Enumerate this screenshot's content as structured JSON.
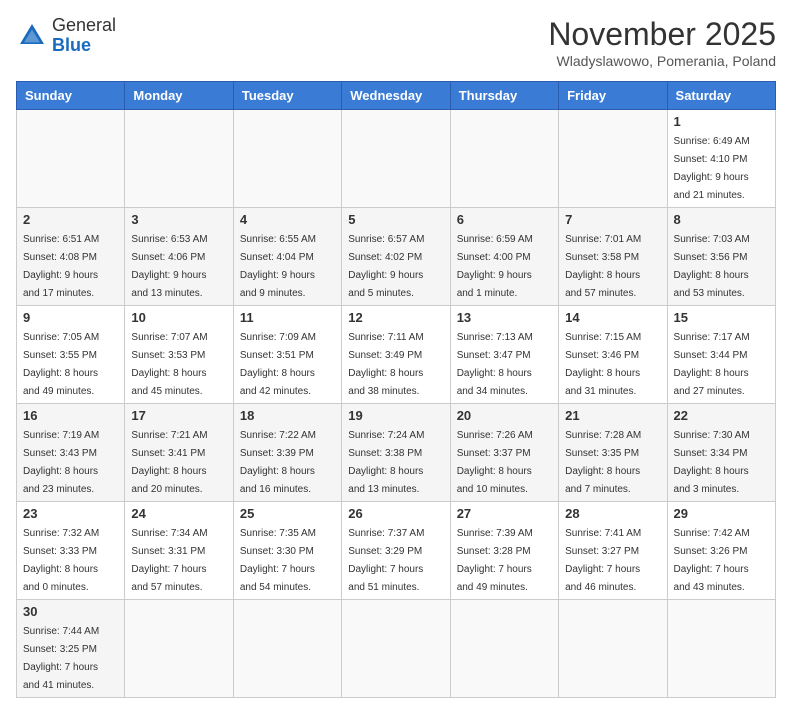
{
  "header": {
    "logo_general": "General",
    "logo_blue": "Blue",
    "month_title": "November 2025",
    "location": "Wladyslawowo, Pomerania, Poland"
  },
  "weekdays": [
    "Sunday",
    "Monday",
    "Tuesday",
    "Wednesday",
    "Thursday",
    "Friday",
    "Saturday"
  ],
  "days": {
    "d1": {
      "num": "1",
      "info": "Sunrise: 6:49 AM\nSunset: 4:10 PM\nDaylight: 9 hours\nand 21 minutes."
    },
    "d2": {
      "num": "2",
      "info": "Sunrise: 6:51 AM\nSunset: 4:08 PM\nDaylight: 9 hours\nand 17 minutes."
    },
    "d3": {
      "num": "3",
      "info": "Sunrise: 6:53 AM\nSunset: 4:06 PM\nDaylight: 9 hours\nand 13 minutes."
    },
    "d4": {
      "num": "4",
      "info": "Sunrise: 6:55 AM\nSunset: 4:04 PM\nDaylight: 9 hours\nand 9 minutes."
    },
    "d5": {
      "num": "5",
      "info": "Sunrise: 6:57 AM\nSunset: 4:02 PM\nDaylight: 9 hours\nand 5 minutes."
    },
    "d6": {
      "num": "6",
      "info": "Sunrise: 6:59 AM\nSunset: 4:00 PM\nDaylight: 9 hours\nand 1 minute."
    },
    "d7": {
      "num": "7",
      "info": "Sunrise: 7:01 AM\nSunset: 3:58 PM\nDaylight: 8 hours\nand 57 minutes."
    },
    "d8": {
      "num": "8",
      "info": "Sunrise: 7:03 AM\nSunset: 3:56 PM\nDaylight: 8 hours\nand 53 minutes."
    },
    "d9": {
      "num": "9",
      "info": "Sunrise: 7:05 AM\nSunset: 3:55 PM\nDaylight: 8 hours\nand 49 minutes."
    },
    "d10": {
      "num": "10",
      "info": "Sunrise: 7:07 AM\nSunset: 3:53 PM\nDaylight: 8 hours\nand 45 minutes."
    },
    "d11": {
      "num": "11",
      "info": "Sunrise: 7:09 AM\nSunset: 3:51 PM\nDaylight: 8 hours\nand 42 minutes."
    },
    "d12": {
      "num": "12",
      "info": "Sunrise: 7:11 AM\nSunset: 3:49 PM\nDaylight: 8 hours\nand 38 minutes."
    },
    "d13": {
      "num": "13",
      "info": "Sunrise: 7:13 AM\nSunset: 3:47 PM\nDaylight: 8 hours\nand 34 minutes."
    },
    "d14": {
      "num": "14",
      "info": "Sunrise: 7:15 AM\nSunset: 3:46 PM\nDaylight: 8 hours\nand 31 minutes."
    },
    "d15": {
      "num": "15",
      "info": "Sunrise: 7:17 AM\nSunset: 3:44 PM\nDaylight: 8 hours\nand 27 minutes."
    },
    "d16": {
      "num": "16",
      "info": "Sunrise: 7:19 AM\nSunset: 3:43 PM\nDaylight: 8 hours\nand 23 minutes."
    },
    "d17": {
      "num": "17",
      "info": "Sunrise: 7:21 AM\nSunset: 3:41 PM\nDaylight: 8 hours\nand 20 minutes."
    },
    "d18": {
      "num": "18",
      "info": "Sunrise: 7:22 AM\nSunset: 3:39 PM\nDaylight: 8 hours\nand 16 minutes."
    },
    "d19": {
      "num": "19",
      "info": "Sunrise: 7:24 AM\nSunset: 3:38 PM\nDaylight: 8 hours\nand 13 minutes."
    },
    "d20": {
      "num": "20",
      "info": "Sunrise: 7:26 AM\nSunset: 3:37 PM\nDaylight: 8 hours\nand 10 minutes."
    },
    "d21": {
      "num": "21",
      "info": "Sunrise: 7:28 AM\nSunset: 3:35 PM\nDaylight: 8 hours\nand 7 minutes."
    },
    "d22": {
      "num": "22",
      "info": "Sunrise: 7:30 AM\nSunset: 3:34 PM\nDaylight: 8 hours\nand 3 minutes."
    },
    "d23": {
      "num": "23",
      "info": "Sunrise: 7:32 AM\nSunset: 3:33 PM\nDaylight: 8 hours\nand 0 minutes."
    },
    "d24": {
      "num": "24",
      "info": "Sunrise: 7:34 AM\nSunset: 3:31 PM\nDaylight: 7 hours\nand 57 minutes."
    },
    "d25": {
      "num": "25",
      "info": "Sunrise: 7:35 AM\nSunset: 3:30 PM\nDaylight: 7 hours\nand 54 minutes."
    },
    "d26": {
      "num": "26",
      "info": "Sunrise: 7:37 AM\nSunset: 3:29 PM\nDaylight: 7 hours\nand 51 minutes."
    },
    "d27": {
      "num": "27",
      "info": "Sunrise: 7:39 AM\nSunset: 3:28 PM\nDaylight: 7 hours\nand 49 minutes."
    },
    "d28": {
      "num": "28",
      "info": "Sunrise: 7:41 AM\nSunset: 3:27 PM\nDaylight: 7 hours\nand 46 minutes."
    },
    "d29": {
      "num": "29",
      "info": "Sunrise: 7:42 AM\nSunset: 3:26 PM\nDaylight: 7 hours\nand 43 minutes."
    },
    "d30": {
      "num": "30",
      "info": "Sunrise: 7:44 AM\nSunset: 3:25 PM\nDaylight: 7 hours\nand 41 minutes."
    }
  }
}
